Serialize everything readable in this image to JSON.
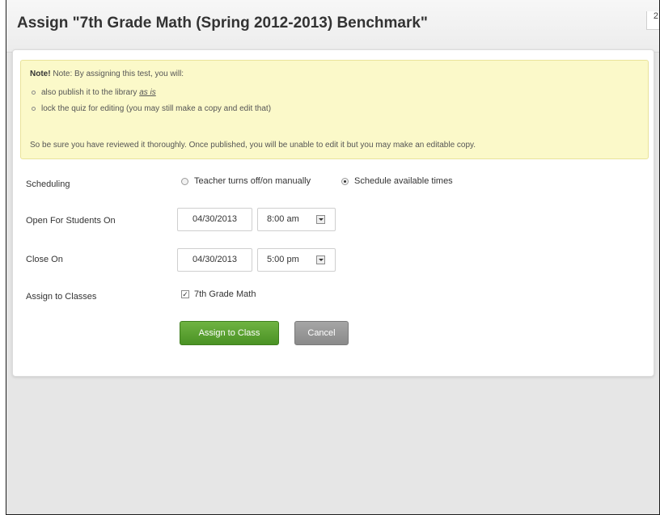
{
  "dialog": {
    "title": "Assign \"7th Grade Math (Spring 2012-2013) Benchmark\"",
    "corner_text": "2"
  },
  "note": {
    "bold_prefix": "Note!",
    "intro": "Note: By assigning this test, you will:",
    "bullet1_text": "also publish it to the library",
    "bullet1_link": "as is",
    "bullet2_text": "lock the quiz for editing (you may still make a copy and edit that)",
    "footer": "So be sure you have reviewed it thoroughly. Once published, you will be unable to edit it but you may make an editable copy."
  },
  "form": {
    "scheduling": {
      "label": "Scheduling",
      "options": [
        "Teacher turns off/on manually",
        "Schedule available times"
      ],
      "selected": "Schedule available times"
    },
    "open": {
      "label": "Open For Students On",
      "date": "04/30/2013",
      "time": "8:00 am"
    },
    "close": {
      "label": "Close On",
      "date": "04/30/2013",
      "time": "5:00 pm"
    },
    "classes": {
      "label": "Assign to Classes",
      "class_name": "7th Grade Math",
      "checked": true
    }
  },
  "buttons": {
    "assign": "Assign to Class",
    "cancel": "Cancel"
  },
  "colors": {
    "note_background": "#fbf9c9",
    "assign_button": "#5aa130",
    "cancel_button": "#999999"
  },
  "icons": {
    "dropdown": "chevron-down-icon",
    "checkbox": "check-icon"
  }
}
